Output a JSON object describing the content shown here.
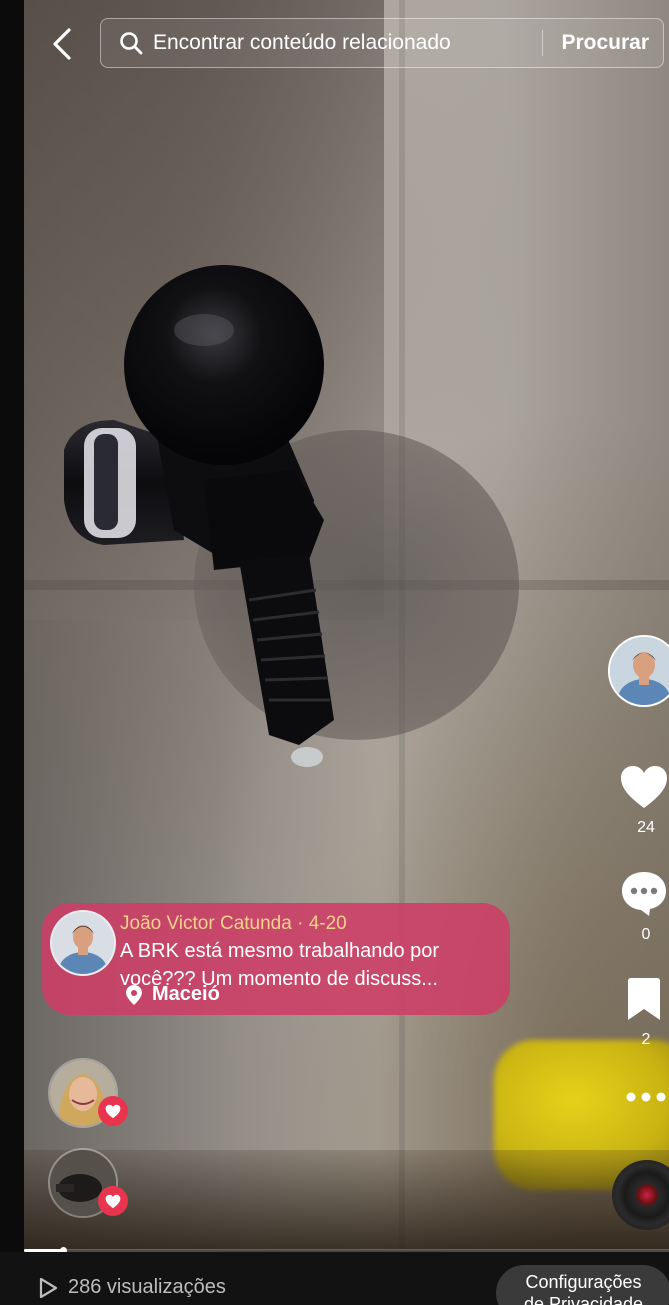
{
  "search": {
    "placeholder": "Encontrar conteúdo relacionado",
    "button_label": "Procurar"
  },
  "icons": {
    "back": "chevron-left-icon",
    "search": "search-icon",
    "like": "heart-icon",
    "comment": "comment-icon",
    "save": "bookmark-icon",
    "more": "more-icon",
    "location": "location-pin-icon",
    "play": "play-icon"
  },
  "actions": {
    "likes": "24",
    "comments": "0",
    "saves": "2"
  },
  "card": {
    "author": "João Victor Catunda · 4-20",
    "text_line1": "A BRK está mesmo trabalhando por",
    "text_line2": "você??? Um momento de discuss...",
    "location": "Maceió"
  },
  "footer": {
    "views": "286 visualizações",
    "privacy_line1": "Configurações",
    "privacy_line2": "de Privacidade"
  },
  "progress": {
    "fraction": 0.06
  },
  "colors": {
    "card": "#ce3e66",
    "heart_badge": "#e8344f",
    "author_highlight": "#f3d38a"
  }
}
